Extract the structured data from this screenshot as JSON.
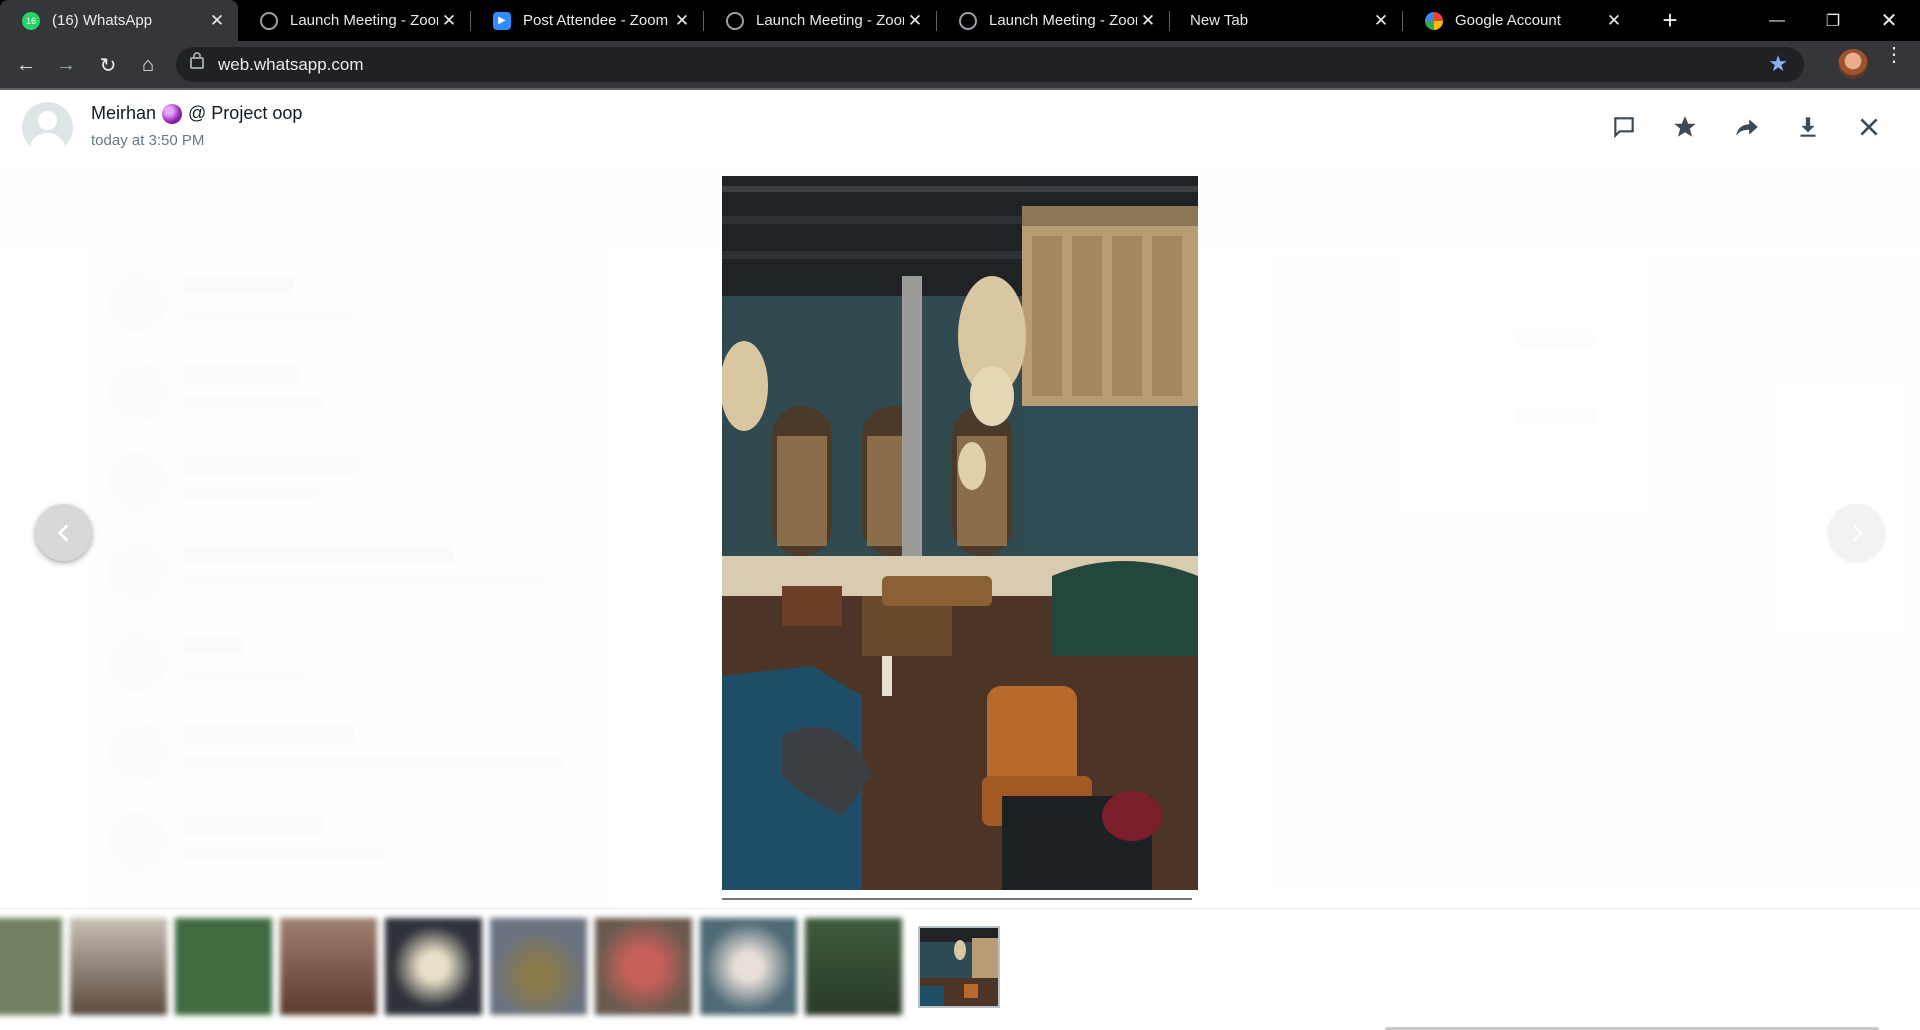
{
  "browser": {
    "tabs": [
      {
        "title": "(16) WhatsApp",
        "icon": "whatsapp-icon",
        "badge": "16",
        "active": true
      },
      {
        "title": "Launch Meeting - Zoom",
        "icon": "globe-icon",
        "active": false
      },
      {
        "title": "Post Attendee - Zoom",
        "icon": "zoom-icon",
        "active": false
      },
      {
        "title": "Launch Meeting - Zoom",
        "icon": "globe-icon",
        "active": false
      },
      {
        "title": "Launch Meeting - Zoom",
        "icon": "globe-icon",
        "active": false
      },
      {
        "title": "New Tab",
        "icon": "",
        "active": false
      },
      {
        "title": "Google Account",
        "icon": "google-icon",
        "active": false
      }
    ],
    "url": "web.whatsapp.com",
    "colors": {
      "tabbar": "#000000",
      "toolbar": "#35363a",
      "omnibox": "#202124",
      "star": "#8ab4f8"
    }
  },
  "viewer": {
    "sender": "Meirhan",
    "chat": "@ Project oop",
    "timestamp": "today at 3:50 PM",
    "actions": [
      "reply-icon",
      "star-icon",
      "forward-icon",
      "download-icon",
      "close-icon"
    ],
    "thumbnails": [
      {
        "icon": "image-thumbnail",
        "color": "#6f7f5f"
      },
      {
        "icon": "image-thumbnail",
        "color": "#a89f96"
      },
      {
        "icon": "image-thumbnail",
        "color": "#3f6b3f"
      },
      {
        "icon": "image-thumbnail",
        "color": "#7a5b4a"
      },
      {
        "icon": "image-thumbnail",
        "color": "#4b4f5a"
      },
      {
        "icon": "image-thumbnail",
        "color": "#6b7280"
      },
      {
        "icon": "image-thumbnail",
        "color": "#8a5a4e"
      },
      {
        "icon": "image-thumbnail",
        "color": "#5e7a86"
      },
      {
        "icon": "image-thumbnail",
        "color": "#3d5a3c"
      },
      {
        "icon": "image-thumbnail-selected",
        "color": "#2e4a55"
      }
    ]
  }
}
